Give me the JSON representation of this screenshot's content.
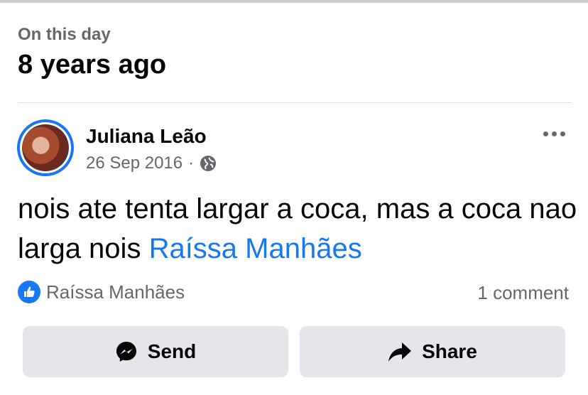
{
  "header": {
    "label": "On this day",
    "title": "8 years ago"
  },
  "post": {
    "author": "Juliana Leão",
    "date": "26 Sep 2016",
    "separator": "·",
    "privacy_icon": "globe-icon",
    "text": "nois ate tenta largar a coca, mas a coca nao larga nois",
    "mention": "Raíssa Manhães",
    "reaction_icon": "like-icon",
    "reacted_by": "Raíssa Manhães",
    "comments": "1 comment"
  },
  "actions": {
    "send_label": "Send",
    "send_icon": "messenger-icon",
    "share_label": "Share",
    "share_icon": "share-arrow-icon"
  },
  "colors": {
    "accent": "#1877f2",
    "secondary_text": "#65676b",
    "button_bg": "#e4e6eb"
  }
}
